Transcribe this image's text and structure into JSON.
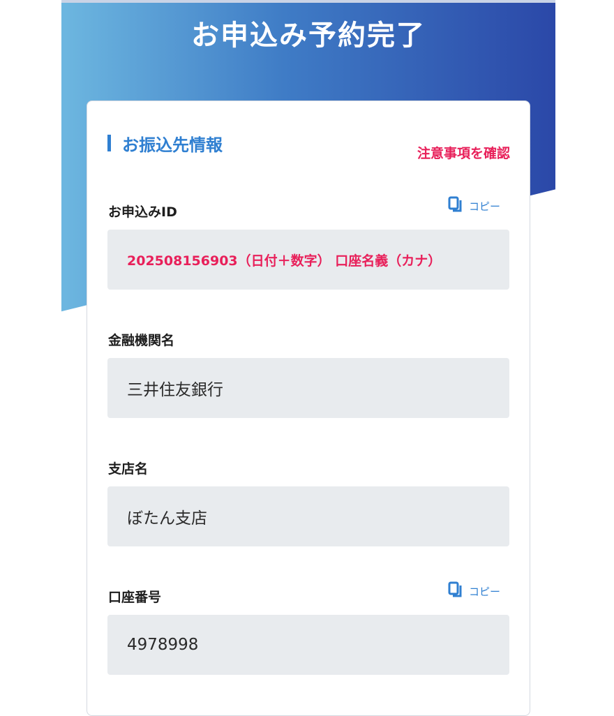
{
  "header": {
    "title": "お申込み予約完了"
  },
  "section": {
    "title": "お振込先情報",
    "notice_link": "注意事項を確認"
  },
  "fields": {
    "application_id": {
      "label": "お申込みID",
      "value": "202508156903（日付＋数字） 口座名義（カナ）",
      "copy_label": "コピー"
    },
    "bank_name": {
      "label": "金融機関名",
      "value": "三井住友銀行"
    },
    "branch_name": {
      "label": "支店名",
      "value": "ぼたん支店"
    },
    "account_number": {
      "label": "口座番号",
      "value": "4978998",
      "copy_label": "コピー"
    }
  },
  "colors": {
    "accent": "#2f7fd1",
    "alert": "#e8205a",
    "field_bg": "#e8ebee"
  },
  "icons": {
    "copy": "copy-icon"
  }
}
